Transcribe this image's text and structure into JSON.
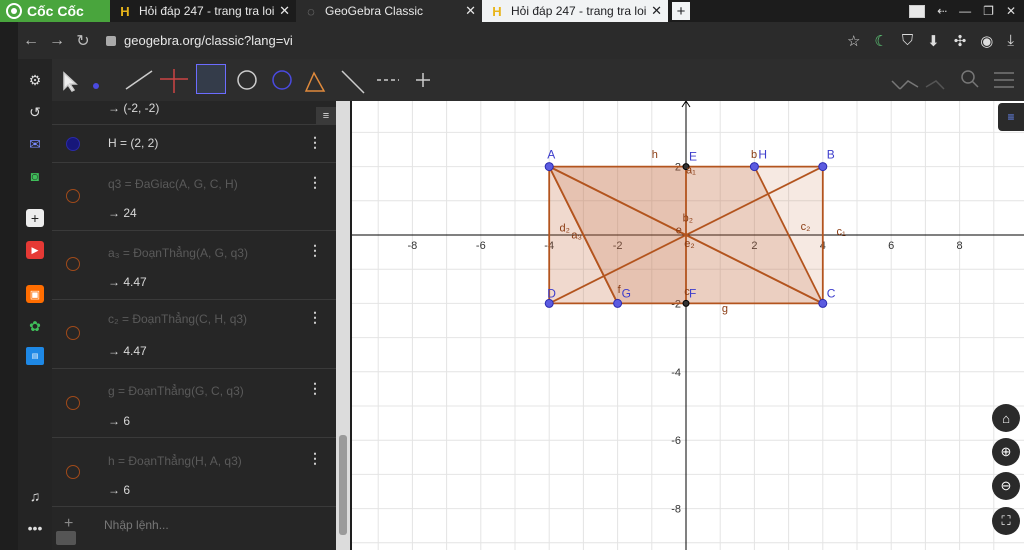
{
  "browser": {
    "brand": "Cốc Cốc",
    "tabs": [
      {
        "title": "Hỏi đáp 247 - trang tra loi",
        "state": "dark"
      },
      {
        "title": "GeoGebra Classic",
        "state": "active"
      },
      {
        "title": "Hỏi đáp 247 - trang tra loi",
        "state": "light"
      }
    ],
    "url": "geogebra.org/classic?lang=vi"
  },
  "algebra": {
    "rows": [
      {
        "def": "",
        "value": "→ (-2, -2)"
      },
      {
        "def": "H = (2, 2)",
        "value": ""
      },
      {
        "def": "q3 = ĐaGiac(A, G, C, H)",
        "value": "→ 24"
      },
      {
        "def": "a₃ = ĐoạnThẳng(A, G, q3)",
        "value": "→ 4.47"
      },
      {
        "def": "c₂ = ĐoạnThẳng(C, H, q3)",
        "value": "→ 4.47"
      },
      {
        "def": "g = ĐoạnThẳng(G, C, q3)",
        "value": "→ 6"
      },
      {
        "def": "h = ĐoạnThẳng(H, A, q3)",
        "value": "→ 6"
      }
    ],
    "input_placeholder": "Nhập lệnh..."
  },
  "graph": {
    "x_ticks": [
      "-8",
      "-6",
      "-4",
      "-2",
      "2",
      "4",
      "6",
      "8"
    ],
    "y_ticks": [
      "2",
      "-2",
      "-4",
      "-6",
      "-8"
    ],
    "points": [
      {
        "label": "A",
        "x": -4,
        "y": 2
      },
      {
        "label": "B",
        "x": 4,
        "y": 2
      },
      {
        "label": "C",
        "x": 4,
        "y": -2
      },
      {
        "label": "D",
        "x": -4,
        "y": -2
      },
      {
        "label": "E",
        "x": 0,
        "y": 2
      },
      {
        "label": "F",
        "x": 0,
        "y": -2
      },
      {
        "label": "G",
        "x": -2,
        "y": -2
      },
      {
        "label": "H",
        "x": 2,
        "y": 2
      }
    ],
    "segment_labels": [
      "h",
      "b",
      "a₁",
      "b₂",
      "e",
      "d₂",
      "a₃",
      "c₂",
      "c₁",
      "e₂",
      "f",
      "c",
      "g"
    ],
    "colors": {
      "edge": "#b3541e",
      "fill": "#c46a3f",
      "point": "#5b5be0",
      "axis": "#000000",
      "grid": "#e4e4e4"
    }
  }
}
